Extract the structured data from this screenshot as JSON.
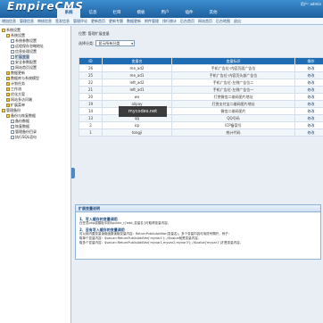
{
  "app": {
    "logo": "EmpireCMS",
    "user": "用户: admin"
  },
  "topnav": {
    "tabs": [
      {
        "label": "系统",
        "active": true
      },
      {
        "label": "信息",
        "active": false
      },
      {
        "label": "栏目",
        "active": false
      },
      {
        "label": "模板",
        "active": false
      },
      {
        "label": "用户",
        "active": false
      },
      {
        "label": "插件",
        "active": false
      },
      {
        "label": "其他",
        "active": false
      }
    ]
  },
  "subnav": {
    "links": [
      "增加信息",
      "管理信息",
      "审核信息",
      "签发信息",
      "管理评论",
      "更新首页",
      "更新专题",
      "数据更新",
      "附件管理",
      "排行统计",
      "后台首页",
      "网站首页",
      "后台地图",
      "退出"
    ]
  },
  "sidebar": {
    "items": [
      {
        "label": "系统设置",
        "indent": 0,
        "kind": "open"
      },
      {
        "label": "系统设置",
        "indent": 1,
        "kind": "open"
      },
      {
        "label": "系统参数设置",
        "indent": 2,
        "kind": "file"
      },
      {
        "label": "远程保存忽略地址",
        "indent": 2,
        "kind": "file"
      },
      {
        "label": "信息处理设置",
        "indent": 2,
        "kind": "file"
      },
      {
        "label": "扩展变量",
        "indent": 2,
        "kind": "file",
        "selected": true
      },
      {
        "label": "安全参数配置",
        "indent": 2,
        "kind": "file"
      },
      {
        "label": "网站首页设置",
        "indent": 2,
        "kind": "file"
      },
      {
        "label": "数据更新",
        "indent": 1,
        "kind": "folder"
      },
      {
        "label": "数据库与系统模型",
        "indent": 1,
        "kind": "folder"
      },
      {
        "label": "计划任务",
        "indent": 1,
        "kind": "folder"
      },
      {
        "label": "工作流",
        "indent": 1,
        "kind": "folder"
      },
      {
        "label": "优化方案",
        "indent": 1,
        "kind": "folder"
      },
      {
        "label": "网站多访问端",
        "indent": 1,
        "kind": "folder"
      },
      {
        "label": "扩展菜单",
        "indent": 1,
        "kind": "folder"
      },
      {
        "label": "管理备份",
        "indent": 0,
        "kind": "open"
      },
      {
        "label": "备份与恢复数据",
        "indent": 1,
        "kind": "open"
      },
      {
        "label": "备份数据",
        "indent": 2,
        "kind": "file"
      },
      {
        "label": "恢复数据",
        "indent": 2,
        "kind": "file"
      },
      {
        "label": "管理备份目录",
        "indent": 2,
        "kind": "file"
      },
      {
        "label": "执行SQL语句",
        "indent": 2,
        "kind": "file"
      }
    ]
  },
  "content": {
    "breadcrumb": "位置: 管理扩展变量",
    "filter_label": "选择分类:",
    "filter_value": "显示所有分类"
  },
  "table": {
    "headers": [
      "ID",
      "变量名",
      "变量标识",
      "操作"
    ],
    "rows": [
      [
        "26",
        "me_ad2",
        "手机广告位-内容页面广告位",
        "修改"
      ],
      [
        "25",
        "me_ad1",
        "手机广告位-内容页头部广告位",
        "修改"
      ],
      [
        "22",
        "left_ad2",
        "手机广告位-左侧广告位二",
        "修改"
      ],
      [
        "21",
        "left_ad1",
        "手机广告位-左侧广告位一",
        "修改"
      ],
      [
        "20",
        "wx",
        "打赏微信二维码图片地址",
        "修改"
      ],
      [
        "19",
        "alipay",
        "打赏支付宝二维码图片地址",
        "修改"
      ],
      [
        "14",
        "weixin",
        "微信二维码图片",
        "修改"
      ],
      [
        "13",
        "qq",
        "QQ号码",
        "修改"
      ],
      [
        "2",
        "icp",
        "ICP备案号",
        "修改"
      ],
      [
        "1",
        "tongji",
        "统计代码",
        "修改"
      ]
    ]
  },
  "watermark": "mycodes.net",
  "help": {
    "title": "扩展变量说明",
    "h1": "1、写入缓存的变量调用",
    "p1": "在任意php或模板中用$public_r['add_变量名']可取得变量内容。",
    "h2": "2、没有写入缓存的变量调用",
    "p2a": "可以用内置变量读取函数读取变量内容：ReturnPublicAddVar(变量名)，多个变量内容可用逗号隔开，例子：",
    "p2b": "取单个变量内容：$value=ReturnPublicAddVar('myvar1'); //$value就是变量内容。",
    "p2c": "取多个变量内容：$value=ReturnPublicAddVar('myvar1,myvar2,myvar3'); //$value['myvar1']才是变量内容。"
  }
}
